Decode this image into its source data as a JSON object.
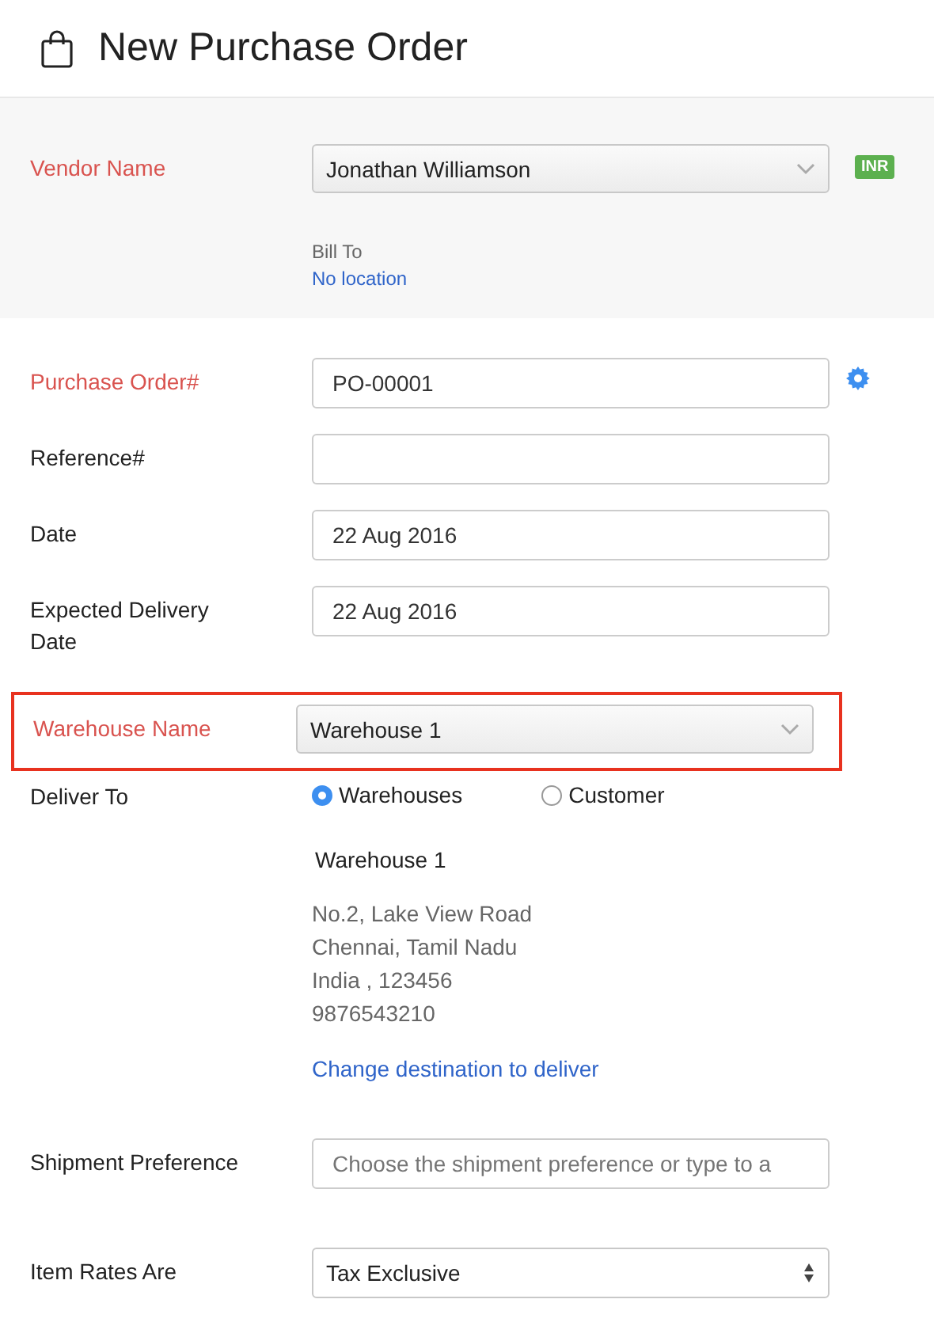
{
  "title": "New Purchase Order",
  "vendor": {
    "label": "Vendor Name",
    "required": true,
    "value": "Jonathan Williamson",
    "currency": "INR",
    "bill_to_label": "Bill To",
    "bill_to_value": "No location"
  },
  "fields": [
    {
      "label": "Purchase Order#",
      "required": true,
      "kind": "input",
      "value": "PO-00001",
      "settings": true,
      "highlighted": false
    },
    {
      "label": "Reference#",
      "required": false,
      "kind": "input",
      "highlighted": false
    },
    {
      "label": "Date",
      "required": false,
      "kind": "input",
      "value": "22 Aug 2016",
      "highlighted": false
    },
    {
      "label": "Expected Delivery Date",
      "required": false,
      "kind": "input",
      "value": "22 Aug 2016",
      "highlighted": false
    },
    {
      "label": "Warehouse Name",
      "required": true,
      "kind": "select",
      "value": "Warehouse 1",
      "highlighted": true
    }
  ],
  "deliver_to": {
    "label": "Deliver To",
    "options": [
      {
        "label": "Warehouses",
        "selected": true
      },
      {
        "label": "Customer",
        "selected": false
      }
    ],
    "name": "Warehouse 1",
    "address": [
      "No.2, Lake View Road",
      "Chennai, Tamil Nadu",
      "India , 123456",
      "9876543210"
    ],
    "link": "Change destination to deliver"
  },
  "shipment": {
    "label": "Shipment Preference",
    "placeholder": "Choose the shipment preference or type to a"
  },
  "item_rates": {
    "label": "Item Rates Are",
    "value": "Tax Exclusive"
  }
}
